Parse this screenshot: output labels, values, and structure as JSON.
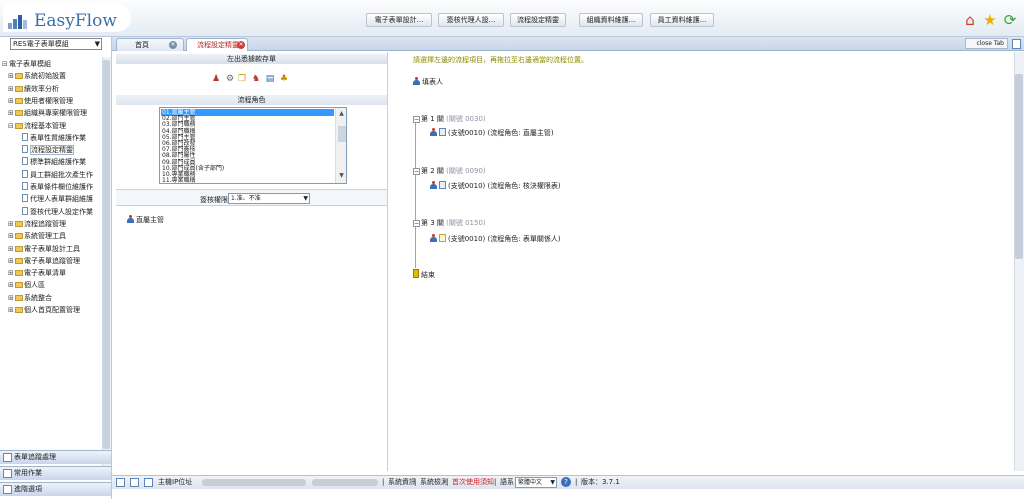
{
  "app": {
    "name": "EasyFlow",
    "brand_color": "#3c6fa9"
  },
  "header": {
    "nav_buttons": [
      "電子表單設計...",
      "簽核代理人設...",
      "流程設定精靈",
      "組織資料維護...",
      "員工資料維護..."
    ],
    "icons": [
      "home-icon",
      "favorite-star-icon",
      "refresh-icon"
    ]
  },
  "sidebar": {
    "module_select": "RES電子表單模組",
    "tree": [
      {
        "label": "電子表單模組",
        "level": 0,
        "type": "root"
      },
      {
        "label": "系統初始設置",
        "level": 1,
        "type": "folder"
      },
      {
        "label": "績效率分析",
        "level": 1,
        "type": "folder"
      },
      {
        "label": "使用者權限管理",
        "level": 1,
        "type": "folder"
      },
      {
        "label": "組織與專案權限管理",
        "level": 1,
        "type": "folder"
      },
      {
        "label": "流程基本管理",
        "level": 1,
        "type": "folder",
        "expanded": true
      },
      {
        "label": "表單性質維護作業",
        "level": 2,
        "type": "doc"
      },
      {
        "label": "流程設定精靈",
        "level": 2,
        "type": "doc",
        "selected": true
      },
      {
        "label": "標準群組維護作業",
        "level": 2,
        "type": "doc"
      },
      {
        "label": "員工群組批次產生作",
        "level": 2,
        "type": "doc"
      },
      {
        "label": "表單條件欄位維護作",
        "level": 2,
        "type": "doc"
      },
      {
        "label": "代理人表單群組維護",
        "level": 2,
        "type": "doc"
      },
      {
        "label": "簽核代理人設定作業",
        "level": 2,
        "type": "doc"
      },
      {
        "label": "流程追蹤管理",
        "level": 1,
        "type": "folder"
      },
      {
        "label": "系統管理工具",
        "level": 1,
        "type": "folder"
      },
      {
        "label": "電子表單設計工具",
        "level": 1,
        "type": "folder"
      },
      {
        "label": "電子表單追蹤管理",
        "level": 1,
        "type": "folder"
      },
      {
        "label": "電子表單清單",
        "level": 1,
        "type": "folder"
      },
      {
        "label": "個人區",
        "level": 1,
        "type": "folder"
      },
      {
        "label": "系統整合",
        "level": 1,
        "type": "folder"
      },
      {
        "label": "個人首頁配置管理",
        "level": 1,
        "type": "folder"
      }
    ],
    "nav_buttons": [
      "表單追蹤處理",
      "常用作業",
      "進階選項"
    ]
  },
  "tabs": [
    {
      "label": "首頁",
      "active": false
    },
    {
      "label": "流程設定精靈",
      "active": true
    }
  ],
  "close_tab_label": "close Tab",
  "left_pane": {
    "drag_title": "左出悉據款存單",
    "role_title": "流程角色",
    "roles": [
      "01.直屬主管",
      "02.部門主管",
      "03.部門職務",
      "04.部門職稱",
      "05.部門主管",
      "06.部門改發",
      "07.部門簽核",
      "08.部門屬性",
      "09.部門成員",
      "10.部門成員(含子部門)",
      "10.專業職務",
      "11.專業職稱"
    ],
    "selected_role_index": 0,
    "perm_label": "簽核權限",
    "perm_value": "1.准、不准",
    "member_label": "直屬主管"
  },
  "right_pane": {
    "instruction": "請選擇左邊的流程項目，再拖拉至右邊適當的流程位置。",
    "start_label": "填表人",
    "steps": [
      {
        "title": "第 1 關",
        "code": "(關號 0030)",
        "detail": "(支號0010) (流程角色: 直屬主管)"
      },
      {
        "title": "第 2 關",
        "code": "(關號 0090)",
        "detail": "(支號0010) (流程角色: 核決權限表)"
      },
      {
        "title": "第 3 關",
        "code": "(關號 0150)",
        "detail": "(支號0010) (流程角色: 表單關係人)"
      }
    ],
    "end_label": "結束"
  },
  "statusbar": {
    "host_label": "主機IP位址",
    "items": [
      "系統資訊",
      "系統檢測"
    ],
    "notice": "首次使用須知",
    "language_label": "語系",
    "language_value": "繁體中文",
    "version_label": "版本：3.7.1",
    "notice_color": "#d02020"
  }
}
